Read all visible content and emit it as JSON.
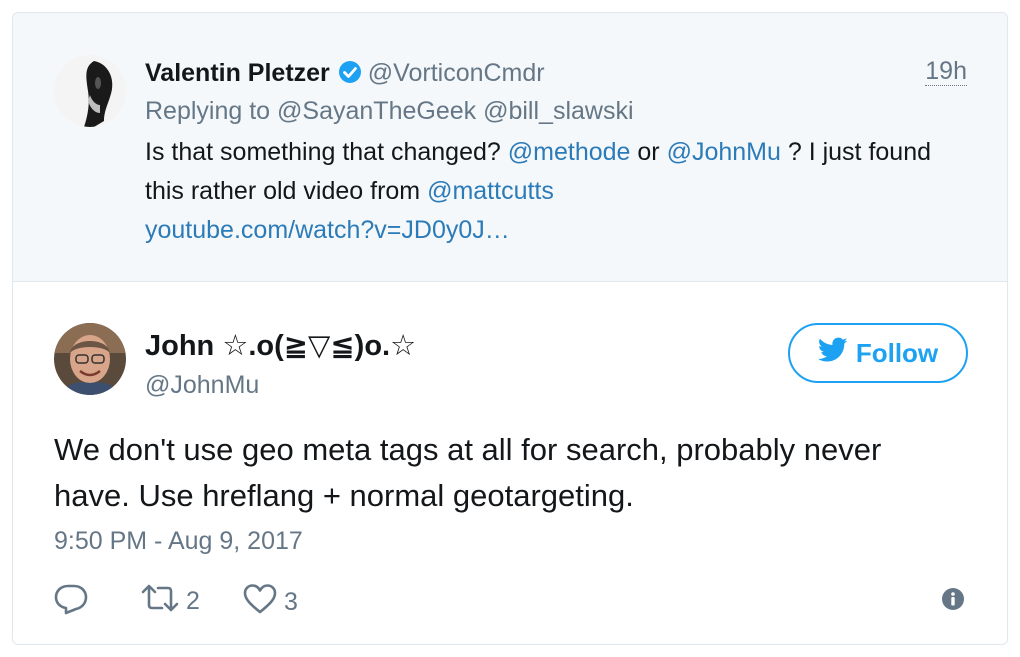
{
  "parent_tweet": {
    "author_name": "Valentin Pletzer",
    "author_handle": "@VorticonCmdr",
    "time": "19h",
    "replying_prefix": "Replying to",
    "replying_to": [
      "@SayanTheGeek",
      "@bill_slawski"
    ],
    "text_1": "Is that something that changed?",
    "mention_1": "@methode",
    "text_2": "or",
    "mention_2": "@JohnMu",
    "text_3": "? I just found this rather old video from",
    "mention_3": "@mattcutts",
    "link": "youtube.com/watch?v=JD0y0J…"
  },
  "main_tweet": {
    "author_name": "John ☆.o(≧▽≦)o.☆",
    "author_handle": "@JohnMu",
    "follow_label": "Follow",
    "text": "We don't use geo meta tags at all for search, probably never have. Use hreflang + normal geotargeting.",
    "timestamp": "9:50 PM - Aug 9, 2017",
    "retweets": "2",
    "likes": "3"
  },
  "icons": {
    "verified": "verified-badge-icon",
    "reply": "reply-icon",
    "retweet": "retweet-icon",
    "like": "heart-icon",
    "info": "info-icon",
    "bird": "twitter-bird-icon"
  },
  "colors": {
    "link": "#2b7bb9",
    "accent": "#1da1f2",
    "muted": "#657786"
  }
}
